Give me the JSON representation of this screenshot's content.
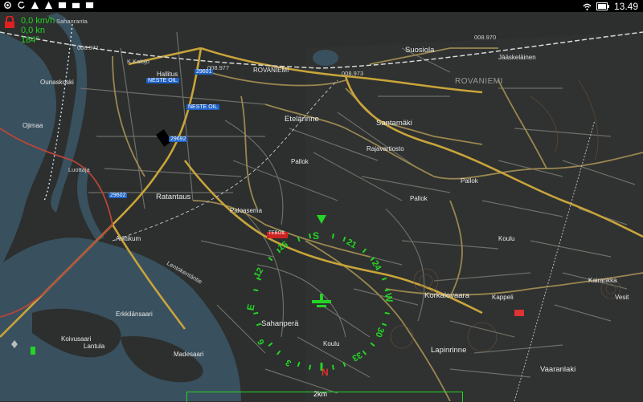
{
  "status_bar": {
    "time": "13.49",
    "left_icons": [
      "location-icon",
      "refresh-icon",
      "warning-icon",
      "warning-icon",
      "image-icon",
      "folder-icon",
      "image-icon"
    ],
    "right_icons": [
      "wifi-icon",
      "battery-icon"
    ]
  },
  "hud": {
    "speed_kmh": "0,0 km/h",
    "speed_kn": "0,0 kn",
    "heading": "184°"
  },
  "compass": {
    "north": "N",
    "south": "S",
    "east": "E",
    "west": "W",
    "ticks": [
      "3",
      "6",
      "12",
      "15",
      "21",
      "24",
      "30",
      "33"
    ]
  },
  "scale": {
    "label": "2km"
  },
  "map_labels": {
    "suosiola": "Suosiola",
    "jaaskelainen": "Jääskeläinen",
    "rovaniemi_area": "ROVANIEMI",
    "rovaniemi_rail": "ROVANIEMI",
    "hallitus": "Hallitus",
    "etelarinne": "Etelärinne",
    "santamaki": "Santamäki",
    "rajavartiosto": "Rajavartiosto",
    "pallok1": "Pallok",
    "pallok2": "Pallok",
    "pallok3": "Pallok",
    "ratantaus": "Ratantaus",
    "paloasema": "Paloasema",
    "arktikum": "Arktikum",
    "korkalovaara": "Korkalovaara",
    "kairankka": "Kairankka",
    "kappeli": "Kappeli",
    "vesit": "Vesit",
    "koulu1": "Koulu",
    "koulu2": "Koulu",
    "sahanpera": "Sahanperä",
    "lapinrinne": "Lapinrinne",
    "vaaranlaki": "Vaaranlaki",
    "erkkilansaari": "Erkkilänsaari",
    "koivusaari": "Koivusaari",
    "madesaari": "Madesaari",
    "lantula": "Lantula",
    "ounaskoski": "Ounaskoski",
    "ojimaa": "Ojimaa",
    "lentokentantie": "Lentokentäntie",
    "luottaja": "Luottaja",
    "kaljo": "K.Kalojo",
    "sahanranta": "Sahanranta",
    "teboil": "TEBOIL",
    "neste1": "NESTE OIL",
    "neste2": "NESTE OIL",
    "road_29601": "29601",
    "road_29602": "29602",
    "road_29692": "29692",
    "rail1": "008.973",
    "rail2": "008.970",
    "rail3": "008.971",
    "rail4": "008.977"
  }
}
